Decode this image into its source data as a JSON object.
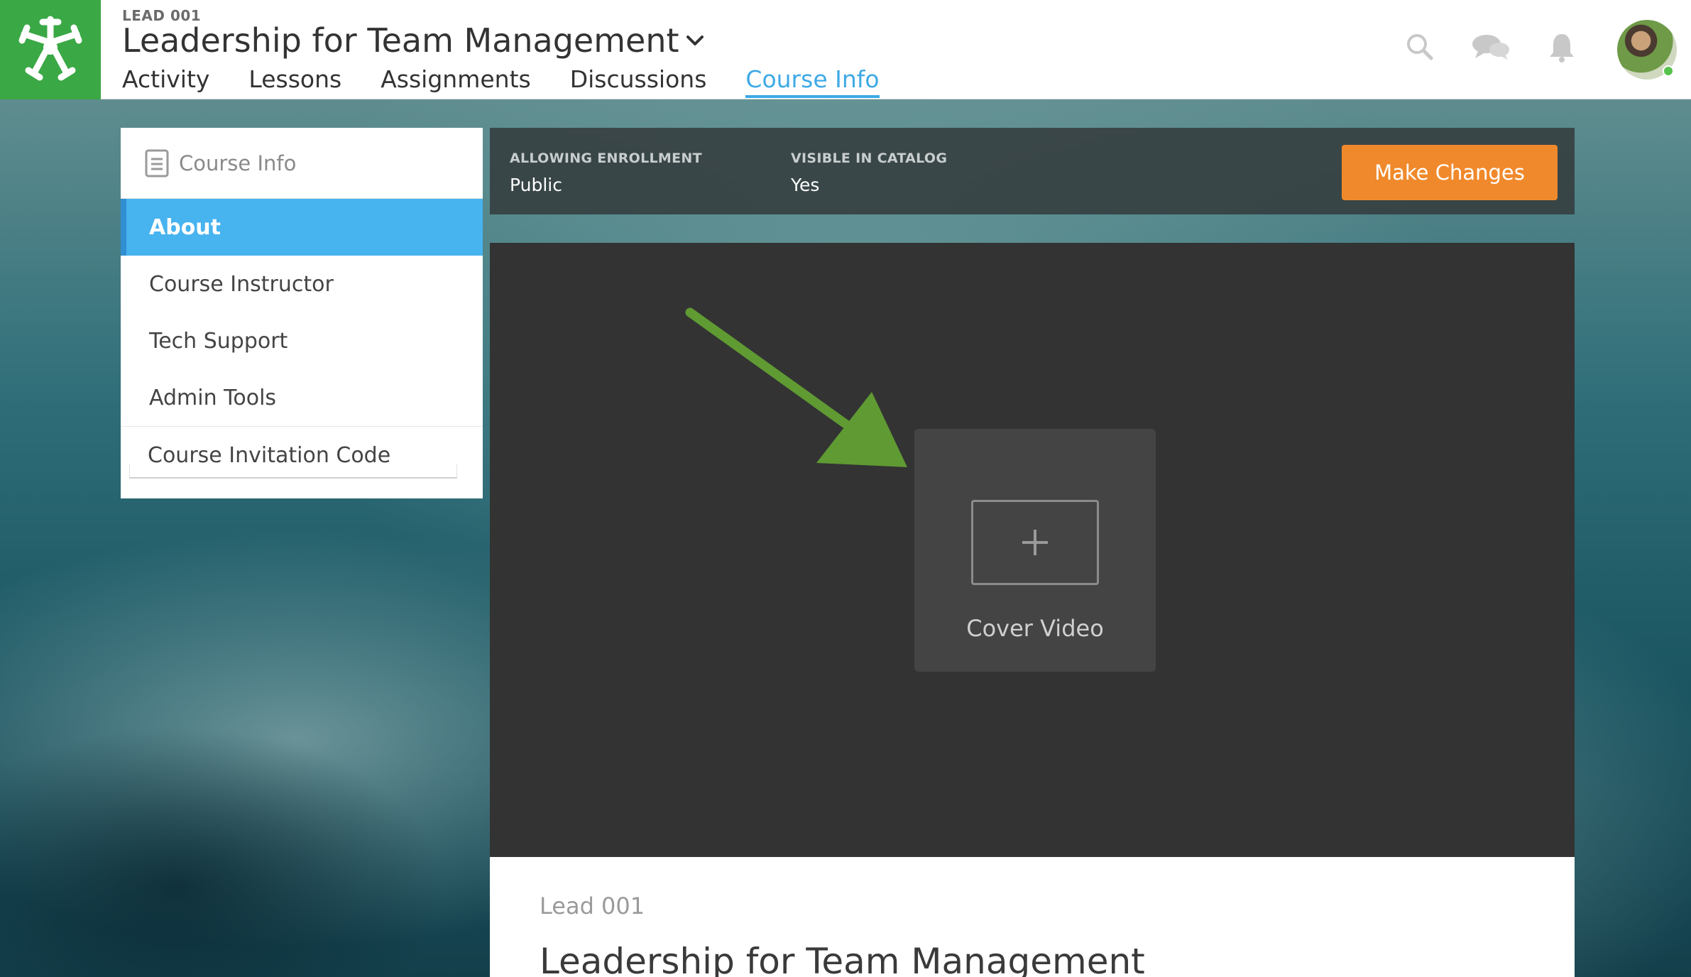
{
  "header": {
    "course_code": "LEAD 001",
    "course_title": "Leadership for Team Management",
    "nav": [
      {
        "label": "Activity"
      },
      {
        "label": "Lessons"
      },
      {
        "label": "Assignments"
      },
      {
        "label": "Discussions"
      },
      {
        "label": "Course Info",
        "active": true
      }
    ],
    "icons": [
      "search-icon",
      "chat-icon",
      "bell-icon",
      "avatar"
    ]
  },
  "sidebar": {
    "title": "Course Info",
    "items": [
      {
        "label": "About",
        "active": true
      },
      {
        "label": "Course Instructor"
      },
      {
        "label": "Tech Support"
      },
      {
        "label": "Admin Tools"
      }
    ],
    "invite_label": "Course Invitation Code"
  },
  "status": {
    "enrollment_label": "ALLOWING ENROLLMENT",
    "enrollment_value": "Public",
    "catalog_label": "VISIBLE IN CATALOG",
    "catalog_value": "Yes",
    "button_label": "Make Changes"
  },
  "media": {
    "cover_label": "Cover Video"
  },
  "about": {
    "code": "Lead 001",
    "title": "Leadership for Team Management"
  },
  "colors": {
    "brand_green": "#3aa845",
    "accent_blue": "#47b3ef",
    "button_orange": "#f0892b",
    "arrow_green": "#5f9a33"
  }
}
